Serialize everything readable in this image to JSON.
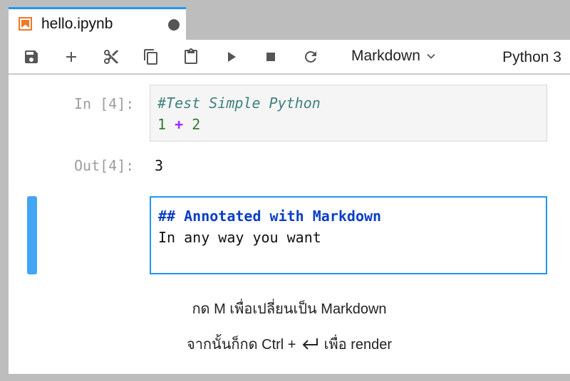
{
  "tab": {
    "title": "hello.ipynb",
    "icon": "notebook-icon",
    "dirty_icon": "unsaved-dot-icon"
  },
  "toolbar": {
    "buttons": [
      "save-icon",
      "add-cell-icon",
      "cut-icon",
      "copy-icon",
      "paste-icon",
      "run-icon",
      "stop-icon",
      "restart-icon"
    ],
    "cell_type": "Markdown",
    "kernel": "Python 3"
  },
  "cells": {
    "code": {
      "prompt_in": "In [4]:",
      "line1": "#Test Simple Python",
      "line2_left": "1",
      "line2_op": "+",
      "line2_right": "2",
      "prompt_out": "Out[4]:",
      "output": "3"
    },
    "markdown": {
      "line1": "## Annotated with Markdown",
      "line2": "In any way you want"
    }
  },
  "hints": {
    "line1": "กด M เพื่อเปลี่ยนเป็น Markdown",
    "line2_prefix": "จากนั้นก็กด Ctrl +",
    "line2_suffix": "เพื่อ render"
  },
  "colors": {
    "accent": "#2196f3",
    "collapser": "#42a5f5",
    "notebook_icon": "#f37726",
    "comment": "#408080",
    "number": "#2e7d32",
    "operator": "#aa22ff",
    "md_header": "#0d3fc4"
  }
}
